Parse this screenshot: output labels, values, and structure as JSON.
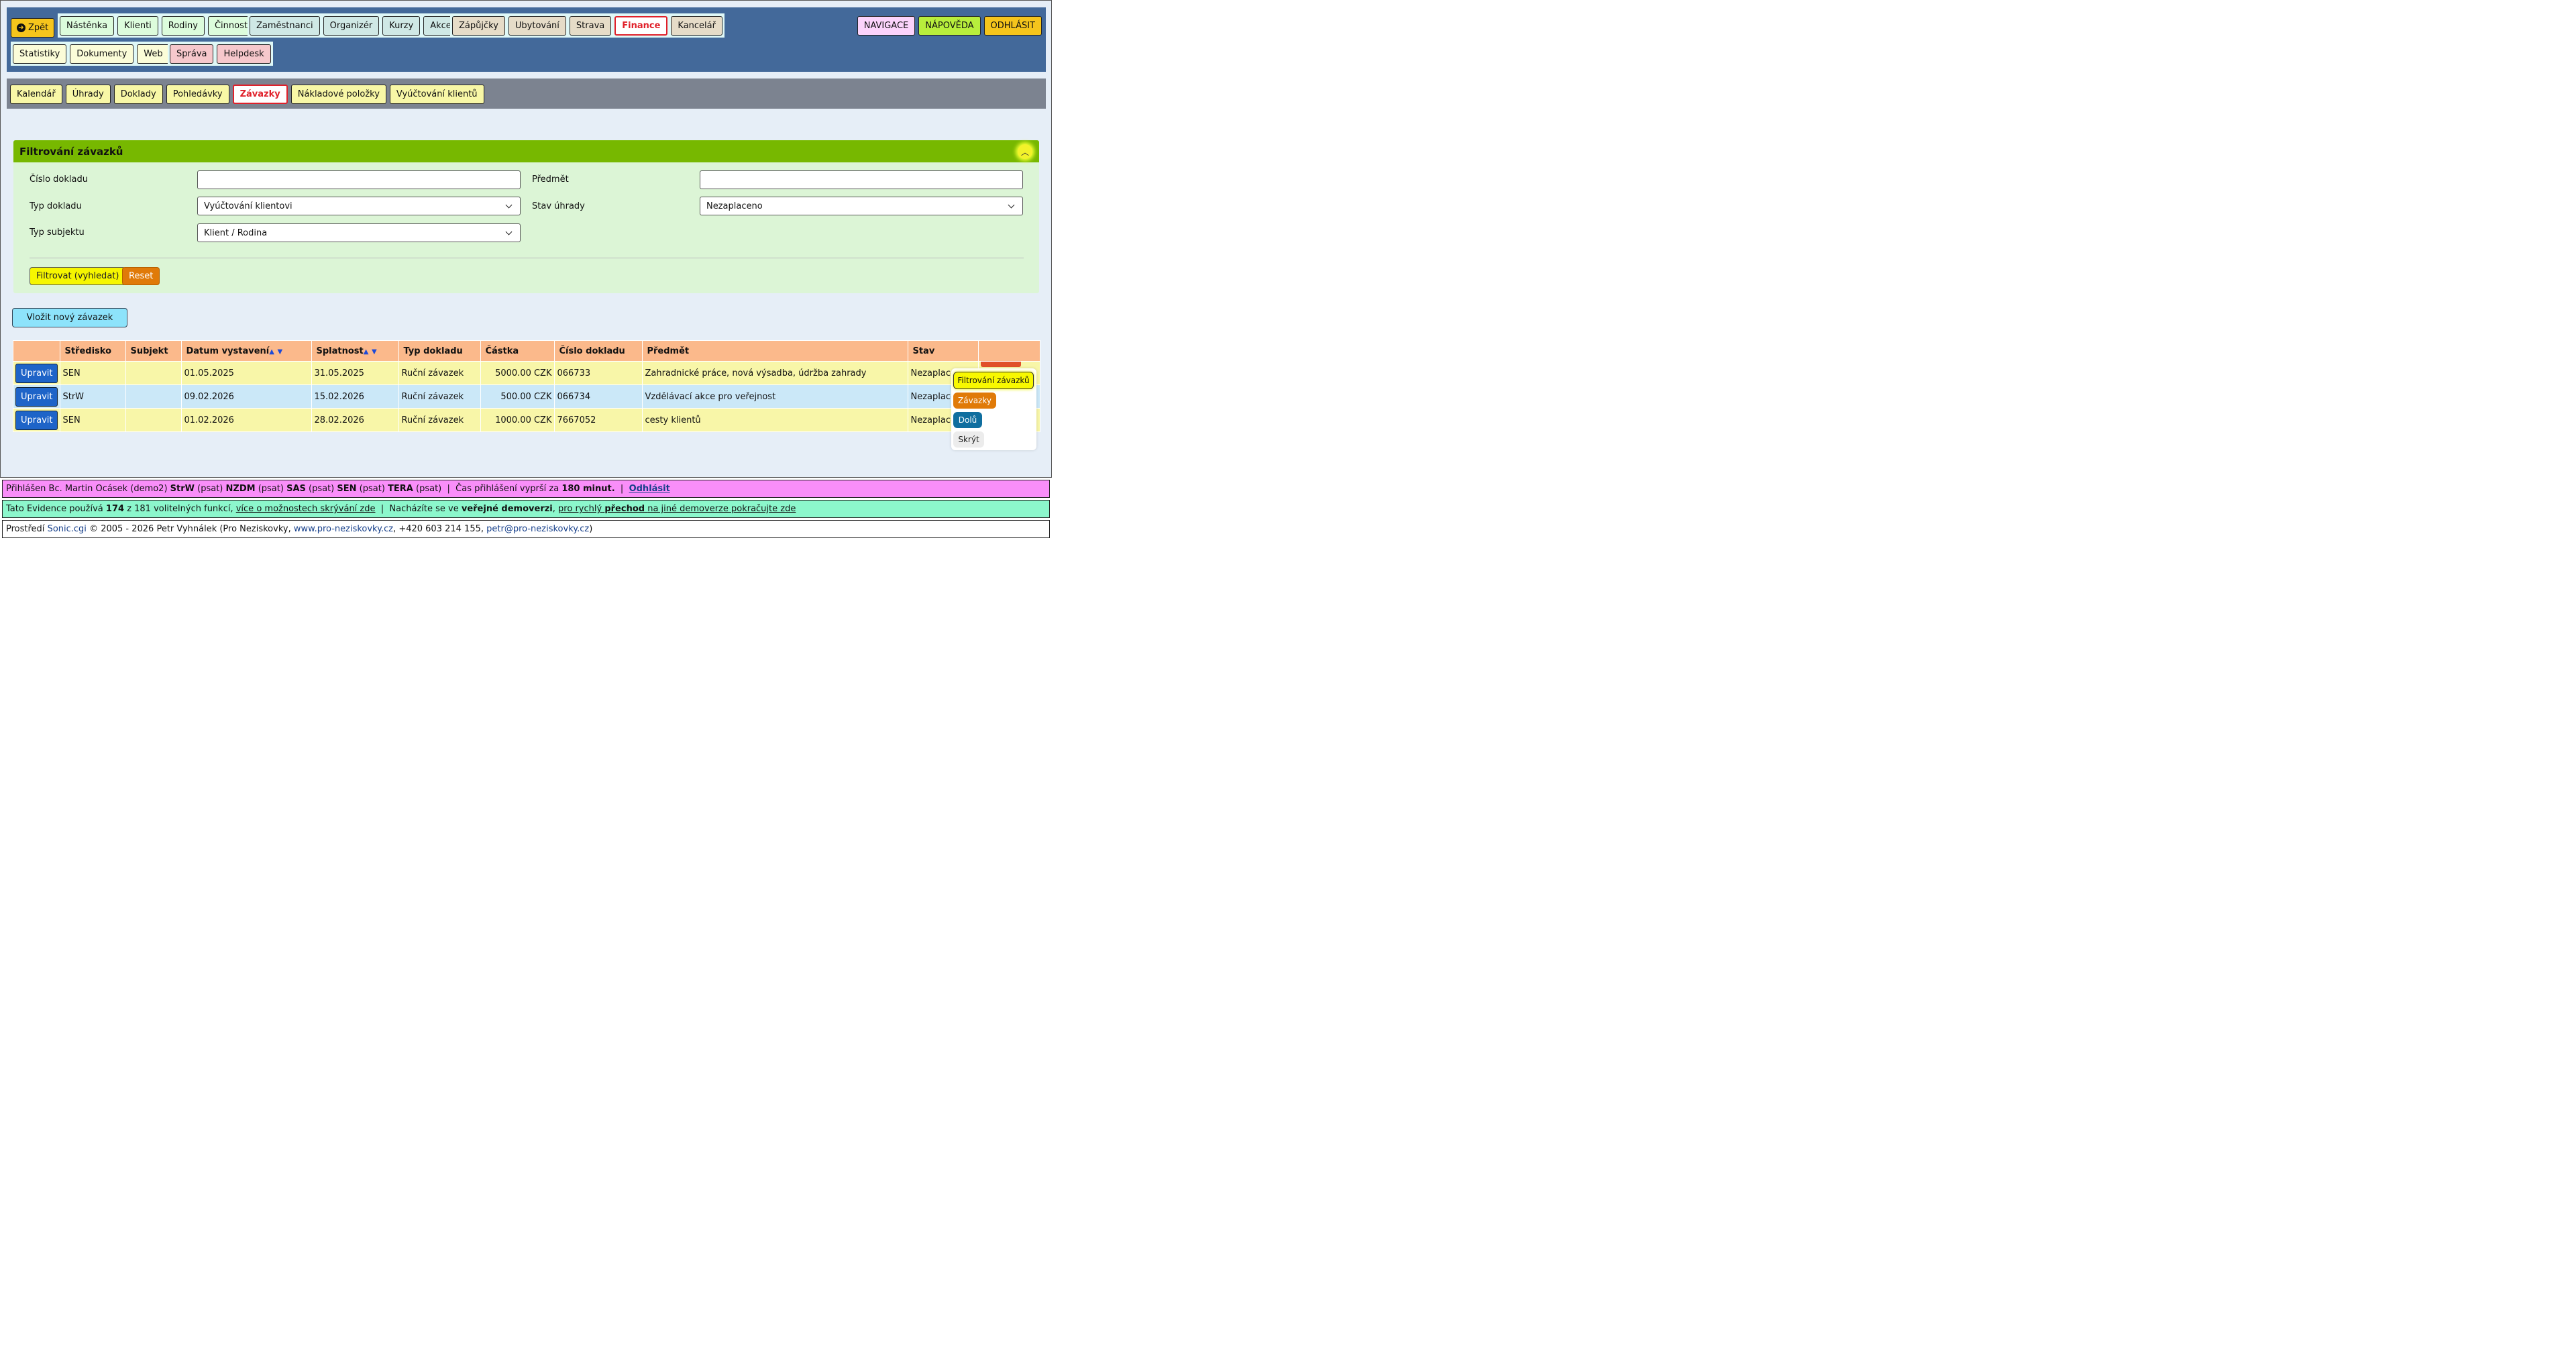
{
  "topnav": {
    "back": "Zpět",
    "group1": [
      "Nástěnka",
      "Klienti",
      "Rodiny",
      "Činnosti"
    ],
    "group2": [
      "Zaměstnanci",
      "Organizér",
      "Kurzy",
      "Akce"
    ],
    "group3": [
      "Zápůjčky",
      "Ubytování",
      "Strava",
      "Finance",
      "Kancelář"
    ],
    "group4": [
      "Statistiky",
      "Dokumenty",
      "Web"
    ],
    "group5": [
      "Správa",
      "Helpdesk"
    ],
    "right": [
      "NAVIGACE",
      "NÁPOVĚDA",
      "ODHLÁSIT"
    ]
  },
  "subnav": [
    "Kalendář",
    "Úhrady",
    "Doklady",
    "Pohledávky",
    "Závazky",
    "Nákladové položky",
    "Vyúčtování klientů"
  ],
  "filter": {
    "title": "Filtrování závazků",
    "labels": {
      "doc_no": "Číslo dokladu",
      "subject": "Předmět",
      "doc_type": "Typ dokladu",
      "pay_state": "Stav úhrady",
      "subj_type": "Typ subjektu"
    },
    "values": {
      "doc_no": "",
      "subject": "",
      "doc_type": "Vyúčtování klientovi",
      "pay_state": "Nezaplaceno",
      "subj_type": "Klient / Rodina"
    },
    "filter_btn": "Filtrovat (vyhledat)",
    "reset_btn": "Reset"
  },
  "insert_btn": "Vložit nový závazek",
  "table": {
    "headers": [
      "",
      "Středisko",
      "Subjekt",
      "Datum vystavení",
      "Splatnost",
      "Typ dokladu",
      "Částka",
      "Číslo dokladu",
      "Předmět",
      "Stav",
      ""
    ],
    "edit_label": "Upravit",
    "rows": [
      {
        "center": "SEN",
        "subject": "",
        "issued": "01.05.2025",
        "due": "31.05.2025",
        "type": "Ruční závazek",
        "amount": "5000.00 CZK",
        "number": "066733",
        "item": "Zahradnické práce, nová výsadba, údržba zahrady",
        "state": "Nezaplaceno"
      },
      {
        "center": "StrW",
        "subject": "",
        "issued": "09.02.2026",
        "due": "15.02.2026",
        "type": "Ruční závazek",
        "amount": "500.00 CZK",
        "number": "066734",
        "item": "Vzdělávací akce pro veřejnost",
        "state": "Nezaplaceno"
      },
      {
        "center": "SEN",
        "subject": "",
        "issued": "01.02.2026",
        "due": "28.02.2026",
        "type": "Ruční závazek",
        "amount": "1000.00 CZK",
        "number": "7667052",
        "item": "cesty klientů",
        "state": "Nezaplaceno"
      }
    ]
  },
  "floating": {
    "filter": "Filtrování závazků",
    "liabilities": "Závazky",
    "down": "Dolů",
    "hide": "Skrýt"
  },
  "footer": {
    "login": {
      "prefix": "Přihlášen Bc. Martin Ocásek (demo2)",
      "c1": "StrW",
      "p1": "(psat)",
      "c2": "NZDM",
      "p2": "(psat)",
      "c3": "SAS",
      "p3": "(psat)",
      "c4": "SEN",
      "p4": "(psat)",
      "c5": "TERA",
      "p5": "(psat)",
      "sep": "|",
      "timeout_pre": "Čas přihlášení vyprší za",
      "timeout": "180 minut.",
      "logout": "Odhlásit"
    },
    "features": {
      "pre": "Tato Evidence používá",
      "count": "174",
      "mid": "z 181 volitelných funkcí,",
      "link1": "více o možnostech skrývání zde",
      "sep": "|",
      "pre2": "Nacházíte se ve",
      "demo": "veřejné demoverzi",
      "comma": ",",
      "link2a": "pro rychlý",
      "link2b": "přechod",
      "link2c": "na jiné demoverze pokračujte zde"
    },
    "copyright": {
      "pre": "Prostředí",
      "sonic": "Sonic.cgi",
      "mid": "© 2005 - 2026 Petr Vyhnálek (Pro Neziskovky,",
      "web": "www.pro-neziskovky.cz",
      "phone": ", +420 603 214 155,",
      "mail": "petr@pro-neziskovky.cz",
      "end": ")"
    }
  },
  "colors": {
    "navbar": "#43699a",
    "subnav": "#7c8390",
    "filter_header": "#77b800",
    "active": "#e0202a",
    "login_bar": "#f98ef9",
    "feature_bar": "#8cf7cc"
  }
}
